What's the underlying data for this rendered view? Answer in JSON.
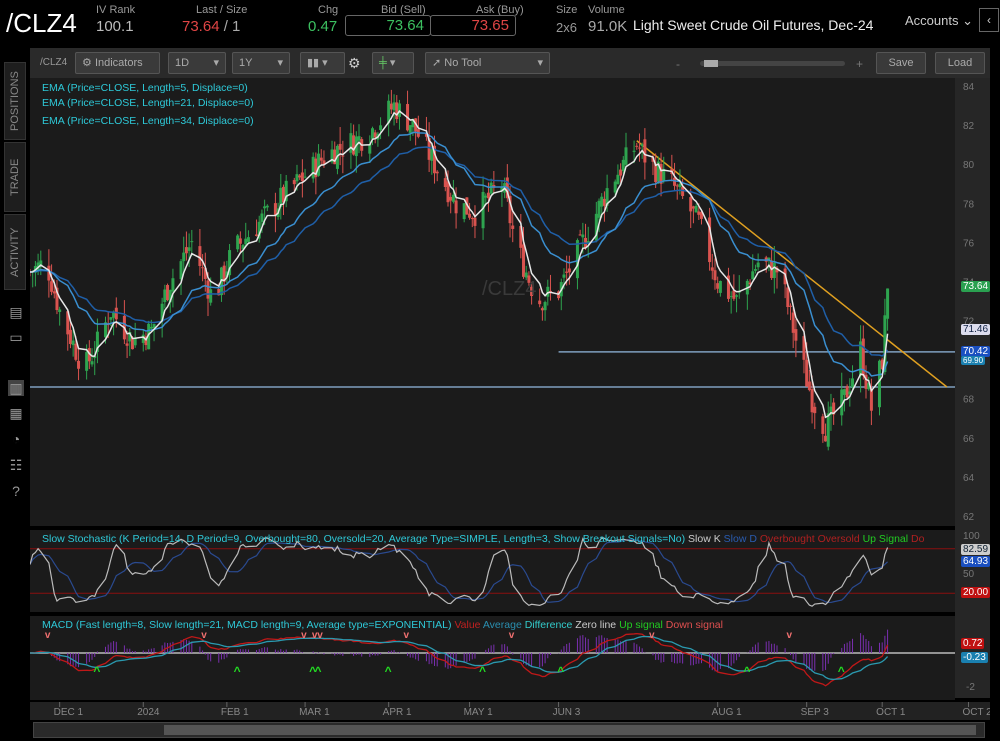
{
  "header": {
    "symbol": "/CLZ4",
    "iv_rank_label": "IV Rank",
    "iv_rank": "100.1",
    "last_label": "Last / Size",
    "last": "73.64",
    "last_size": "/ 1",
    "chg_label": "Chg",
    "chg": "0.47",
    "bid_label": "Bid (Sell)",
    "bid": "73.64",
    "ask_label": "Ask (Buy)",
    "ask": "73.65",
    "size_label": "Size",
    "size": "2x6",
    "volume_label": "Volume",
    "volume": "91.0K",
    "description": "Light Sweet Crude Oil Futures, Dec-24",
    "accounts": "Accounts"
  },
  "toolbar": {
    "symbol": "/CLZ4",
    "indicators": "Indicators",
    "aggregation": "1D",
    "period": "1Y",
    "tool": "No Tool",
    "zoom_minus": "-",
    "zoom_plus": "+",
    "save": "Save",
    "load": "Load"
  },
  "sidebar": {
    "tabs": [
      "POSITIONS",
      "TRADE",
      "ACTIVITY"
    ]
  },
  "studies": {
    "ema": [
      "EMA (Price=CLOSE, Length=5, Displace=0)",
      "EMA (Price=CLOSE, Length=21, Displace=0)",
      "EMA (Price=CLOSE, Length=34, Displace=0)"
    ],
    "stoch": "Slow Stochastic (K Period=14, D Period=9, Overbought=80, Oversold=20, Average Type=SIMPLE, Length=3, Show Breakout Signals=No)",
    "stoch_legend": [
      "Slow K",
      "Slow D",
      "Overbought",
      "Oversold",
      "Up Signal",
      "Do"
    ],
    "macd": "MACD (Fast length=8, Slow length=21, MACD length=9, Average type=EXPONENTIAL)",
    "macd_legend": [
      "Value",
      "Average",
      "Difference",
      "Zero line",
      "Up signal",
      "Down signal"
    ]
  },
  "watermark": "/CLZ4",
  "price_tags": {
    "last": "73.64",
    "ema5": "71.46",
    "ema21": "70.42",
    "ema34": "69.90",
    "stoch_k": "82.59",
    "stoch_d": "64.93",
    "stoch_mid": "50",
    "stoch_os": "20.00",
    "stoch_top": "100",
    "macd_value": "0.72",
    "macd_avg": "-0.23",
    "macd_low": "-2"
  },
  "colors": {
    "up": "#2ea44f",
    "down": "#d9534f",
    "ema5": "#e8e8e8",
    "ema21": "#3a8fd0",
    "ema34": "#1f5fa8",
    "trend": "#e0a020",
    "support": "#7f9fbf"
  },
  "chart_data": {
    "type": "candlestick",
    "ylim": [
      62,
      84
    ],
    "y_ticks": [
      "84",
      "82",
      "80",
      "78",
      "76",
      "74",
      "72",
      "70",
      "68",
      "66",
      "64",
      "62"
    ],
    "x_ticks": [
      "DEC 1",
      "2024",
      "FEB 1",
      "MAR 1",
      "APR 1",
      "MAY 1",
      "JUN 3",
      "AUG 1",
      "SEP 3",
      "OCT 1",
      "OCT 2"
    ],
    "x_tick_days": [
      11,
      42,
      73,
      102,
      133,
      163,
      196,
      255,
      288,
      316,
      348
    ],
    "close_keypoints_day_price": [
      [
        0,
        74.5
      ],
      [
        6,
        75
      ],
      [
        11,
        72.5
      ],
      [
        20,
        69.5
      ],
      [
        24,
        70.5
      ],
      [
        30,
        72.5
      ],
      [
        38,
        71
      ],
      [
        45,
        71.5
      ],
      [
        52,
        74
      ],
      [
        60,
        76
      ],
      [
        68,
        73
      ],
      [
        75,
        75.5
      ],
      [
        85,
        77
      ],
      [
        95,
        78.5
      ],
      [
        110,
        80.5
      ],
      [
        125,
        81.5
      ],
      [
        135,
        83
      ],
      [
        142,
        82
      ],
      [
        150,
        80
      ],
      [
        158,
        78
      ],
      [
        165,
        77.5
      ],
      [
        175,
        79
      ],
      [
        180,
        76
      ],
      [
        188,
        73
      ],
      [
        196,
        73.5
      ],
      [
        205,
        76
      ],
      [
        215,
        79
      ],
      [
        225,
        81
      ],
      [
        230,
        80
      ],
      [
        238,
        79
      ],
      [
        248,
        77
      ],
      [
        255,
        74
      ],
      [
        262,
        73
      ],
      [
        270,
        75
      ],
      [
        278,
        74.5
      ],
      [
        284,
        71
      ],
      [
        290,
        68
      ],
      [
        295,
        66.5
      ],
      [
        302,
        68
      ],
      [
        308,
        70.5
      ],
      [
        312,
        67.5
      ],
      [
        316,
        70
      ],
      [
        318,
        73.64
      ]
    ],
    "trendline": [
      [
        225,
        81.2
      ],
      [
        340,
        68.6
      ]
    ],
    "support_levels": [
      70.4,
      68.6
    ]
  }
}
